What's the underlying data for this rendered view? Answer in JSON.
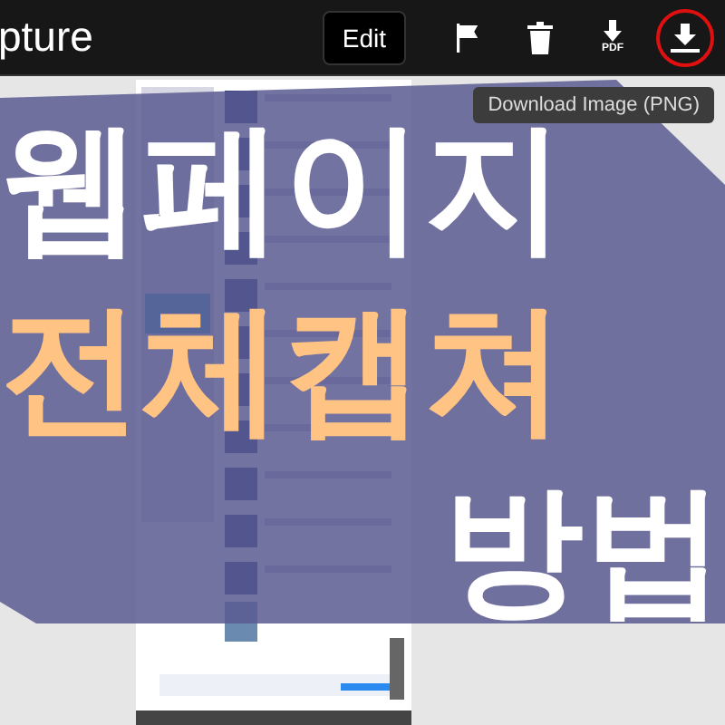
{
  "toolbar": {
    "title": "pture",
    "actions": [
      {
        "kind": "edit",
        "label": "Edit",
        "circled": false
      },
      {
        "kind": "flag",
        "circled": false
      },
      {
        "kind": "trash",
        "circled": false
      },
      {
        "kind": "pdf",
        "label": "PDF",
        "circled": false
      },
      {
        "kind": "png",
        "circled": true
      }
    ]
  },
  "tooltip": "Download Image (PNG)",
  "overlay_lines": [
    {
      "text": "웹페이지",
      "color": "#ffffff",
      "right_aligned": false
    },
    {
      "text": "전체캡쳐",
      "color": "#ffc384",
      "right_aligned": false
    },
    {
      "text": "방법",
      "color": "#ffffff",
      "right_aligned": true
    }
  ]
}
